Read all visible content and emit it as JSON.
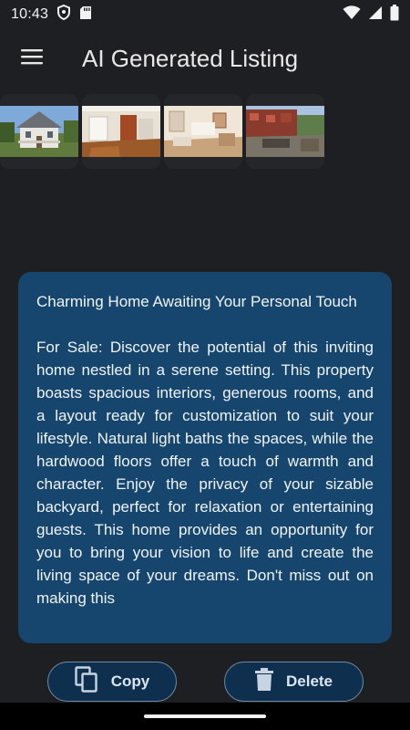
{
  "status_bar": {
    "time": "10:43",
    "left_icons": [
      "shield-icon",
      "sd-card-icon"
    ],
    "right_icons": [
      "wifi-icon",
      "signal-icon",
      "battery-icon"
    ]
  },
  "app_bar": {
    "title": "AI Generated Listing",
    "menu_icon": "menu-icon"
  },
  "photos": [
    {
      "name": "photo-house-exterior"
    },
    {
      "name": "photo-living-room"
    },
    {
      "name": "photo-bedroom"
    },
    {
      "name": "photo-backyard"
    }
  ],
  "listing": {
    "title": "Charming Home Awaiting Your Personal Touch",
    "body": "For Sale: Discover the potential of this inviting home nestled in a serene setting. This property boasts spacious interiors, generous rooms, and a layout ready for customization to suit your lifestyle. Natural light baths the spaces, while the hardwood floors offer a touch of warmth and character. Enjoy the privacy of your sizable backyard, perfect for relaxation or entertaining guests. This home provides an opportunity for you to bring your vision to life and create the living space of your dreams. Don't miss out on making this"
  },
  "actions": {
    "copy_label": "Copy",
    "delete_label": "Delete"
  },
  "colors": {
    "background": "#1e1f22",
    "card": "#16456d",
    "button": "#0e2f4d"
  }
}
